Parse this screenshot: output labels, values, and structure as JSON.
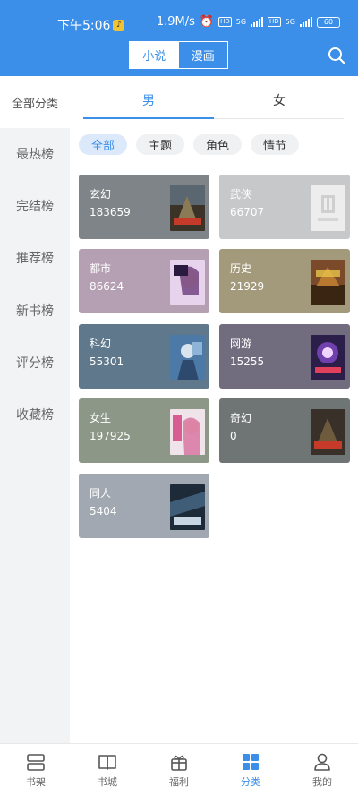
{
  "status": {
    "time": "下午5:06",
    "speed": "1.9M/s",
    "net1": "5G",
    "net2": "5G",
    "battery": "60"
  },
  "header": {
    "tabs": [
      {
        "label": "小说",
        "active": true
      },
      {
        "label": "漫画",
        "active": false
      }
    ],
    "search_icon": "search-icon"
  },
  "sidebar": {
    "all_label": "全部分类",
    "items": [
      {
        "label": "最热榜"
      },
      {
        "label": "完结榜"
      },
      {
        "label": "推荐榜"
      },
      {
        "label": "新书榜"
      },
      {
        "label": "评分榜"
      },
      {
        "label": "收藏榜"
      }
    ]
  },
  "gender_tabs": [
    {
      "label": "男",
      "active": true
    },
    {
      "label": "女",
      "active": false
    }
  ],
  "filters": [
    {
      "label": "全部",
      "active": true
    },
    {
      "label": "主题",
      "active": false
    },
    {
      "label": "角色",
      "active": false
    },
    {
      "label": "情节",
      "active": false
    }
  ],
  "categories": [
    {
      "name": "玄幻",
      "count": "183659",
      "color": "#7e8487",
      "cover_color": "#3b3327",
      "cover_text": "不朽神皇"
    },
    {
      "name": "武侠",
      "count": "66707",
      "color": "#c7c8ca",
      "cover_color": "#eeeeee",
      "cover_text": ""
    },
    {
      "name": "都市",
      "count": "86624",
      "color": "#b59fb3",
      "cover_color": "#c9a9d8",
      "cover_text": "逆天"
    },
    {
      "name": "历史",
      "count": "21929",
      "color": "#a39a7c",
      "cover_color": "#7a4a2a",
      "cover_text": "天下"
    },
    {
      "name": "科幻",
      "count": "55301",
      "color": "#60788b",
      "cover_color": "#4d79a6",
      "cover_text": ""
    },
    {
      "name": "网游",
      "count": "15255",
      "color": "#726d7e",
      "cover_color": "#2b1f4a",
      "cover_text": "狂神"
    },
    {
      "name": "女生",
      "count": "197925",
      "color": "#8c9787",
      "cover_color": "#efe4ea",
      "cover_text": "神医"
    },
    {
      "name": "奇幻",
      "count": "0",
      "color": "#6f7574",
      "cover_color": "#3a302a",
      "cover_text": "不朽"
    },
    {
      "name": "同人",
      "count": "5404",
      "color": "#a2a8b1",
      "cover_color": "#1d2a38",
      "cover_text": "神印王座"
    }
  ],
  "bottom_nav": [
    {
      "label": "书架",
      "icon": "bookshelf-icon",
      "active": false
    },
    {
      "label": "书城",
      "icon": "book-open-icon",
      "active": false
    },
    {
      "label": "福利",
      "icon": "gift-icon",
      "active": false
    },
    {
      "label": "分类",
      "icon": "category-grid-icon",
      "active": true
    },
    {
      "label": "我的",
      "icon": "user-icon",
      "active": false
    }
  ],
  "colors": {
    "accent": "#3c8fe8",
    "sidebar_bg": "#f2f3f5",
    "chip_bg": "#f0f1f3",
    "chip_active_bg": "#dbe9fb"
  }
}
